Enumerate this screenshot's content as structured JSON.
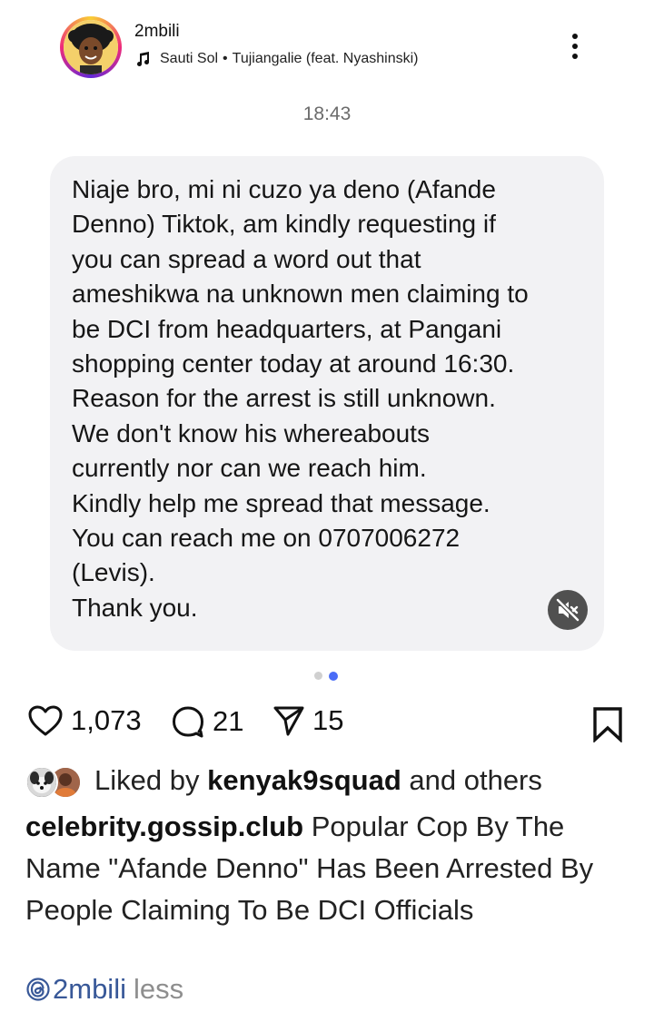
{
  "header": {
    "username": "2mbili",
    "music": {
      "artist": "Sauti Sol",
      "separator": "•",
      "track": "Tujiangalie (feat. Nyashinski)"
    }
  },
  "message": {
    "timestamp": "18:43",
    "text": "Niaje bro, mi ni cuzo ya deno (Afande\nDenno) Tiktok, am kindly requesting if\nyou can spread a word out that\nameshikwa na unknown men claiming to\nbe DCI from headquarters, at Pangani\nshopping center today at around 16:30.\nReason for the arrest is still unknown.\nWe don't know his whereabouts\ncurrently nor can we reach him.\nKindly help me spread that message.\nYou can reach me on 0707006272\n(Levis).\nThank you."
  },
  "carousel": {
    "total": 2,
    "active_index": 1
  },
  "actions": {
    "likes": "1,073",
    "comments": "21",
    "shares": "15"
  },
  "liked_by": {
    "prefix": "Liked by",
    "user": "kenyak9squad",
    "suffix": "and others"
  },
  "caption": {
    "username": "celebrity.gossip.club",
    "text": "Popular Cop By The Name \"Afande Denno\" Has Been Arrested By People Claiming To Be DCI Officials"
  },
  "mention": {
    "handle": "2mbili",
    "less_label": "less"
  },
  "colors": {
    "accent": "#4a6cf7",
    "mention": "#385898",
    "bubble": "#f2f2f4",
    "muted_text": "#8e8e8e"
  }
}
